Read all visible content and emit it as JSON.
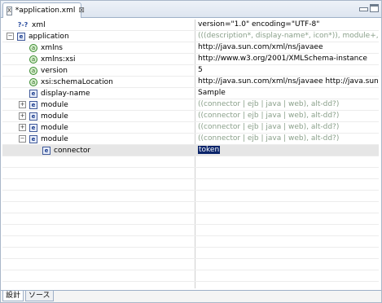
{
  "tab": {
    "icon": "xml-file-icon",
    "title": "*application.xml",
    "close": "⊠"
  },
  "rows": [
    {
      "type": "pi",
      "indent": 0,
      "expander": "",
      "icon": "q",
      "icon_text": "?-?",
      "label": "xml",
      "value": "version=\"1.0\" encoding=\"UTF-8\"",
      "gray": false
    },
    {
      "type": "elem",
      "indent": 0,
      "expander": "−",
      "icon": "e",
      "icon_text": "e",
      "label": "application",
      "value": "(((description*, display-name*, icon*)), module+, security-r",
      "gray": true
    },
    {
      "type": "attr",
      "indent": 1,
      "expander": "",
      "icon": "a",
      "icon_text": "a",
      "label": "xmlns",
      "value": "http://java.sun.com/xml/ns/javaee",
      "gray": false
    },
    {
      "type": "attr",
      "indent": 1,
      "expander": "",
      "icon": "a",
      "icon_text": "a",
      "label": "xmlns:xsi",
      "value": "http://www.w3.org/2001/XMLSchema-instance",
      "gray": false
    },
    {
      "type": "attr",
      "indent": 1,
      "expander": "",
      "icon": "a",
      "icon_text": "a",
      "label": "version",
      "value": "5",
      "gray": false
    },
    {
      "type": "attr",
      "indent": 1,
      "expander": "",
      "icon": "a",
      "icon_text": "a",
      "label": "xsi:schemaLocation",
      "value": "http://java.sun.com/xml/ns/javaee http://java.sun.com/xml",
      "gray": false
    },
    {
      "type": "elem",
      "indent": 1,
      "expander": "",
      "icon": "e",
      "icon_text": "e",
      "label": "display-name",
      "value": "Sample",
      "gray": false
    },
    {
      "type": "elem",
      "indent": 1,
      "expander": "+",
      "icon": "e",
      "icon_text": "e",
      "label": "module",
      "value": "((connector | ejb | java | web), alt-dd?)",
      "gray": true
    },
    {
      "type": "elem",
      "indent": 1,
      "expander": "+",
      "icon": "e",
      "icon_text": "e",
      "label": "module",
      "value": "((connector | ejb | java | web), alt-dd?)",
      "gray": true
    },
    {
      "type": "elem",
      "indent": 1,
      "expander": "+",
      "icon": "e",
      "icon_text": "e",
      "label": "module",
      "value": "((connector | ejb | java | web), alt-dd?)",
      "gray": true
    },
    {
      "type": "elem",
      "indent": 1,
      "expander": "−",
      "icon": "e",
      "icon_text": "e",
      "label": "module",
      "value": "((connector | ejb | java | web), alt-dd?)",
      "gray": true
    },
    {
      "type": "elem",
      "indent": 2,
      "expander": "",
      "icon": "e",
      "icon_text": "e",
      "label": "connector",
      "value": "token",
      "gray": false,
      "selected": true
    }
  ],
  "bottom_tabs": {
    "design": "設計",
    "source": "ソース"
  }
}
